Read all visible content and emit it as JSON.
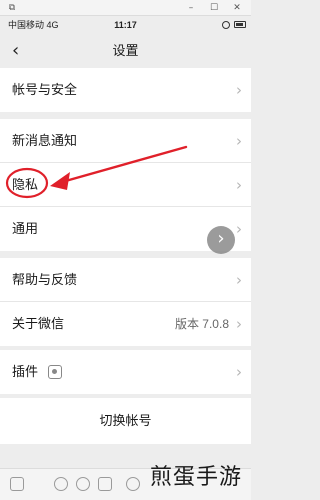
{
  "window": {
    "restore": "⧉",
    "minimize": "–",
    "maximize": "☐",
    "close": "✕"
  },
  "status": {
    "carrier": "中国移动 4G",
    "time": "11:17"
  },
  "nav": {
    "back": "‹",
    "title": "设置"
  },
  "groups": [
    {
      "items": [
        {
          "label": "帐号与安全",
          "chevron": "›"
        }
      ]
    },
    {
      "items": [
        {
          "label": "新消息通知",
          "chevron": "›"
        },
        {
          "label": "隐私",
          "chevron": "›"
        },
        {
          "label": "通用",
          "chevron": "›"
        }
      ]
    },
    {
      "items": [
        {
          "label": "帮助与反馈",
          "chevron": "›"
        },
        {
          "label": "关于微信",
          "value": "版本 7.0.8",
          "chevron": "›"
        }
      ]
    },
    {
      "items": [
        {
          "label": "插件",
          "chevron": "›"
        }
      ]
    },
    {
      "items": [
        {
          "label": "切换帐号"
        }
      ]
    }
  ],
  "annotation": {
    "color": "#e0202a"
  },
  "watermark": "煎蛋手游"
}
